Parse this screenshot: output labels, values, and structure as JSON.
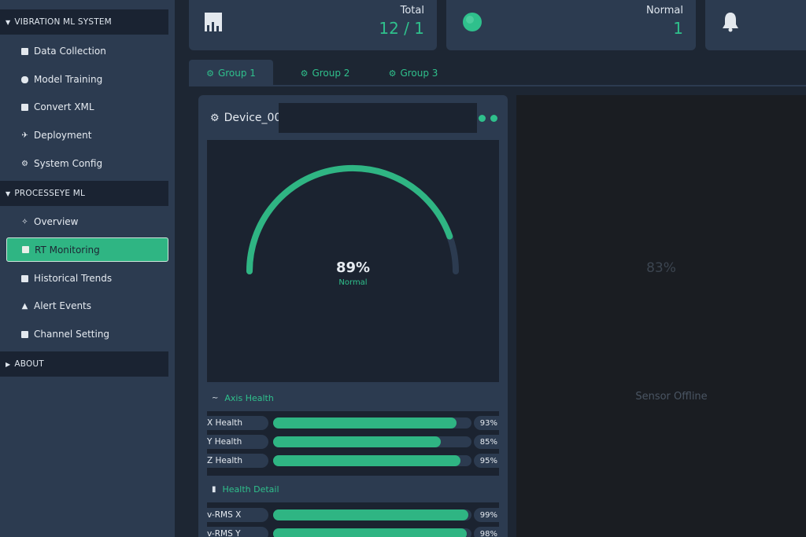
{
  "sidebar": {
    "sections": [
      {
        "title": "VIBRATION ML SYSTEM",
        "items": [
          {
            "label": "Data Collection",
            "icon": "database-icon"
          },
          {
            "label": "Model Training",
            "icon": "brain-icon"
          },
          {
            "label": "Convert XML",
            "icon": "file-icon"
          },
          {
            "label": "Deployment",
            "icon": "rocket-icon"
          },
          {
            "label": "System Config",
            "icon": "gear-icon"
          }
        ]
      },
      {
        "title": "PROCESSEYE ML",
        "items": [
          {
            "label": "Overview",
            "icon": "pin-icon"
          },
          {
            "label": "RT Monitoring",
            "icon": "monitor-icon",
            "active": true
          },
          {
            "label": "Historical Trends",
            "icon": "chart-icon"
          },
          {
            "label": "Alert Events",
            "icon": "bell-icon"
          },
          {
            "label": "Channel Setting",
            "icon": "sliders-icon"
          }
        ]
      },
      {
        "title": "ABOUT",
        "items": []
      }
    ]
  },
  "stats": [
    {
      "label": "Total",
      "value": "12 / 1",
      "icon": "building-icon"
    },
    {
      "label": "Normal",
      "value": "1",
      "icon": "status-dot-icon"
    },
    {
      "label": "",
      "value": "",
      "icon": "bell-icon"
    }
  ],
  "tabs": [
    {
      "label": "Group 1",
      "active": true
    },
    {
      "label": "Group 2",
      "active": false
    },
    {
      "label": "Group 3",
      "active": false
    }
  ],
  "device": {
    "name": "Device_00",
    "status_colors": [
      "#2fc08c",
      "#2fc08c"
    ],
    "gauge": {
      "value": 89,
      "display": "89%",
      "status": "Normal"
    },
    "axis_health": {
      "title": "Axis Health",
      "rows": [
        {
          "label": "X Health",
          "value": 93,
          "pct": "93%"
        },
        {
          "label": "Y Health",
          "value": 85,
          "pct": "85%"
        },
        {
          "label": "Z Health",
          "value": 95,
          "pct": "95%"
        }
      ]
    },
    "health_detail": {
      "title": "Health Detail",
      "rows": [
        {
          "label": "v-RMS X",
          "value": 99,
          "pct": "99%"
        },
        {
          "label": "v-RMS Y",
          "value": 98,
          "pct": "98%"
        }
      ]
    }
  },
  "offline_panel": {
    "gauge_text": "83%",
    "status": "Sensor Offline"
  },
  "colors": {
    "accent": "#2fc08c",
    "sidebar": "#2c3b50",
    "background": "#1d2633"
  }
}
